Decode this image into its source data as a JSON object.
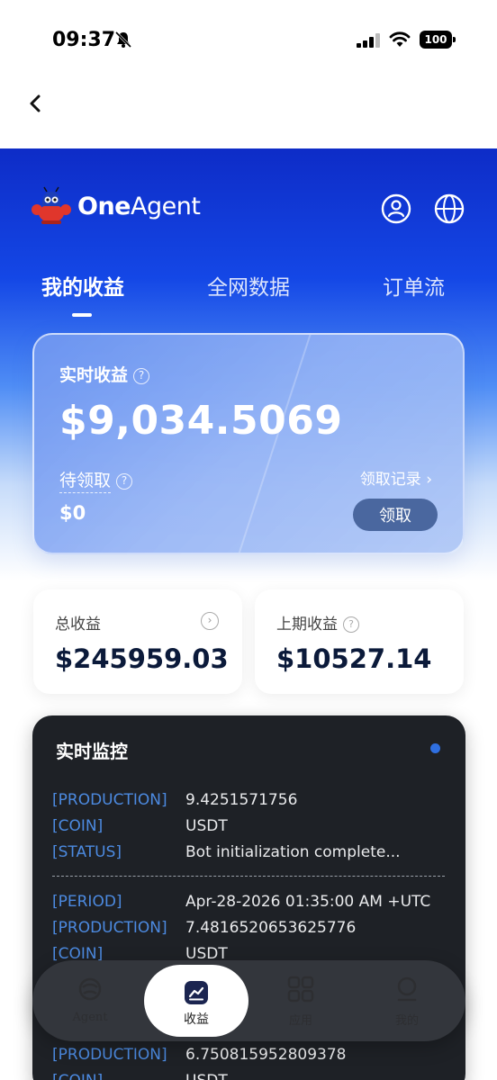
{
  "status_bar": {
    "time": "09:37",
    "battery": "100"
  },
  "header": {
    "brand_bold": "One",
    "brand_light": "Agent"
  },
  "tabs": [
    {
      "label": "我的收益",
      "active": true
    },
    {
      "label": "全网数据",
      "active": false
    },
    {
      "label": "订单流",
      "active": false
    }
  ],
  "earnings_card": {
    "realtime_label": "实时收益",
    "realtime_value": "$9,034.5069",
    "pending_label": "待领取",
    "pending_value": "$0",
    "claim_record_label": "领取记录 ›",
    "claim_button": "领取"
  },
  "stats": {
    "total": {
      "label": "总收益",
      "value": "$245959.03"
    },
    "last_period": {
      "label": "上期收益",
      "value": "$10527.14"
    }
  },
  "monitor": {
    "title": "实时监控",
    "entries": [
      {
        "key": "[PRODUCTION]",
        "value": "9.4251571756"
      },
      {
        "key": "[COIN]",
        "value": "USDT"
      },
      {
        "key": "[STATUS]",
        "value": "Bot initialization complete..."
      },
      {
        "key": "[PERIOD]",
        "value": "Apr-28-2026 01:35:00 AM +UTC"
      },
      {
        "key": "[PRODUCTION]",
        "value": "7.4816520653625776"
      },
      {
        "key": "[COIN]",
        "value": "USDT"
      },
      {
        "key": "[PRODUCTION]",
        "value": "6.750815952809378"
      },
      {
        "key": "[COIN]",
        "value": "USDT"
      }
    ]
  },
  "bottom_nav": [
    {
      "label": "Agent",
      "icon": "agent-icon"
    },
    {
      "label": "收益",
      "icon": "earnings-chart-icon",
      "active": true
    },
    {
      "label": "应用",
      "icon": "apps-grid-icon"
    },
    {
      "label": "我的",
      "icon": "profile-icon"
    }
  ],
  "colors": {
    "hero_blue": "#1447e6",
    "monitor_bg": "#1e2126",
    "log_key": "#4c8ae0",
    "claim_button": "#4a679f"
  }
}
